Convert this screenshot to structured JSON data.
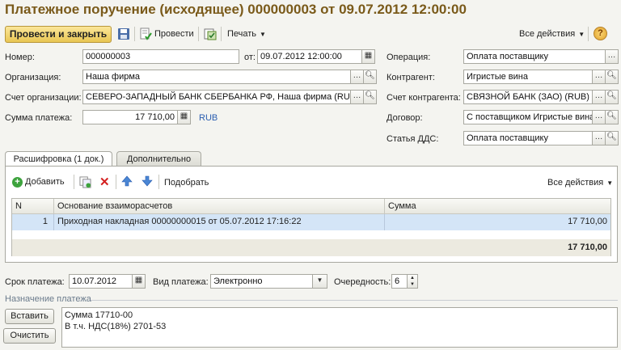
{
  "window": {
    "title": "Платежное поручение (исходящее) 000000003 от 09.07.2012 12:00:00"
  },
  "toolbar": {
    "post_close_label": "Провести и закрыть",
    "post_label": "Провести",
    "print_label": "Печать",
    "all_actions_label": "Все действия",
    "help_glyph": "?"
  },
  "form": {
    "number_label": "Номер:",
    "number_value": "000000003",
    "date_label": "от:",
    "date_value": "09.07.2012 12:00:00",
    "org_label": "Организация:",
    "org_value": "Наша фирма",
    "org_account_label": "Счет организации:",
    "org_account_value": "СЕВЕРО-ЗАПАДНЫЙ БАНК СБЕРБАНКА РФ, Наша фирма (RUB)",
    "amount_label": "Сумма платежа:",
    "amount_value": "17 710,00",
    "currency": "RUB",
    "operation_label": "Операция:",
    "operation_value": "Оплата поставщику",
    "counterparty_label": "Контрагент:",
    "counterparty_value": "Игристые вина",
    "cp_account_label": "Счет контрагента:",
    "cp_account_value": "СВЯЗНОЙ БАНК (ЗАО) (RUB)",
    "contract_label": "Договор:",
    "contract_value": "С поставщиком Игристые вина",
    "dds_label": "Статья ДДС:",
    "dds_value": "Оплата поставщику"
  },
  "tabs": [
    {
      "label": "Расшифровка (1 док.)"
    },
    {
      "label": "Дополнительно"
    }
  ],
  "grid_toolbar": {
    "add_label": "Добавить",
    "select_label": "Подобрать",
    "all_actions_label": "Все действия"
  },
  "grid": {
    "columns": [
      "N",
      "Основание взаиморасчетов",
      "Сумма"
    ],
    "rows": [
      {
        "n": "1",
        "basis": "Приходная накладная 00000000015 от 05.07.2012 17:16:22",
        "sum": "17 710,00"
      }
    ],
    "total": "17 710,00"
  },
  "footer": {
    "due_label": "Срок платежа:",
    "due_value": "10.07.2012",
    "pay_type_label": "Вид платежа:",
    "pay_type_value": "Электронно",
    "priority_label": "Очередность:",
    "priority_value": "6",
    "purpose_title": "Назначение платежа",
    "insert_label": "Вставить",
    "clear_label": "Очистить",
    "purpose_line1": "Сумма 17710-00",
    "purpose_line2": "В т.ч. НДС(18%) 2701-53"
  },
  "colors": {
    "title": "#7a5a1a",
    "primary_button": "#e9c653",
    "selected_row": "#d4e5f7",
    "link_currency": "#2a5db0"
  }
}
